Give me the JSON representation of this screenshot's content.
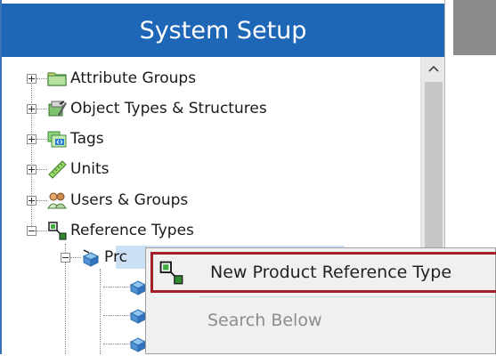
{
  "panel": {
    "title": "System Setup"
  },
  "tree": {
    "items": [
      {
        "label": "Attribute Groups",
        "expanded": false,
        "icon": "folder-icon"
      },
      {
        "label": "Object Types & Structures",
        "expanded": false,
        "icon": "object-types-icon"
      },
      {
        "label": "Tags",
        "expanded": false,
        "icon": "tags-icon"
      },
      {
        "label": "Units",
        "expanded": false,
        "icon": "ruler-icon"
      },
      {
        "label": "Users & Groups",
        "expanded": false,
        "icon": "users-icon"
      },
      {
        "label": "Reference Types",
        "expanded": true,
        "icon": "reference-types-icon"
      },
      {
        "label": "Prc",
        "expanded": true,
        "icon": "product-cube-icon"
      }
    ]
  },
  "context_menu": {
    "items": [
      {
        "label": "New Product Reference Type",
        "highlighted": true,
        "enabled": true,
        "icon": "reference-type-icon"
      },
      {
        "label": "Search Below",
        "highlighted": false,
        "enabled": false,
        "icon": ""
      }
    ]
  },
  "colors": {
    "header_bg": "#1e66b6",
    "selection_bg": "#cce0f5",
    "highlight_border": "#a3202a",
    "menu_bg": "#f0f0f0"
  }
}
